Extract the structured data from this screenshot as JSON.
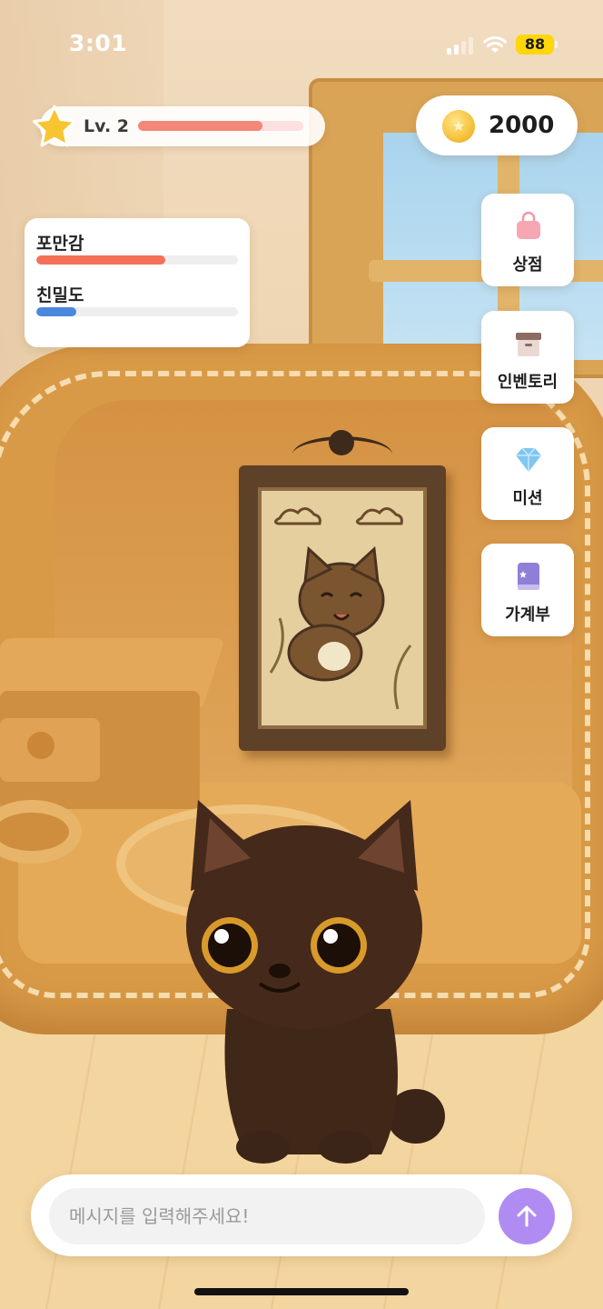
{
  "status_bar": {
    "time": "3:01",
    "battery": "88",
    "battery_color": "#ffd60a"
  },
  "player": {
    "level_label": "Lv. 2",
    "level_progress": 0.75,
    "level_bar_color": "#f48777",
    "level_icon": "star-icon"
  },
  "currency": {
    "coins": "2000",
    "coin_icon": "coin-icon",
    "coin_color": "#f7c542"
  },
  "stats": [
    {
      "label": "포만감",
      "value": 0.64,
      "color": "#f47157"
    },
    {
      "label": "친밀도",
      "value": 0.2,
      "color": "#4b87de"
    }
  ],
  "menu": [
    {
      "label": "상점",
      "icon": "shopping-bag-icon"
    },
    {
      "label": "인벤토리",
      "icon": "storage-box-icon"
    },
    {
      "label": "미션",
      "icon": "diamond-icon"
    },
    {
      "label": "가계부",
      "icon": "book-icon"
    }
  ],
  "chat": {
    "placeholder": "메시지를 입력해주세요!",
    "send_icon": "arrow-up-icon",
    "send_color": "#b08cf2"
  }
}
